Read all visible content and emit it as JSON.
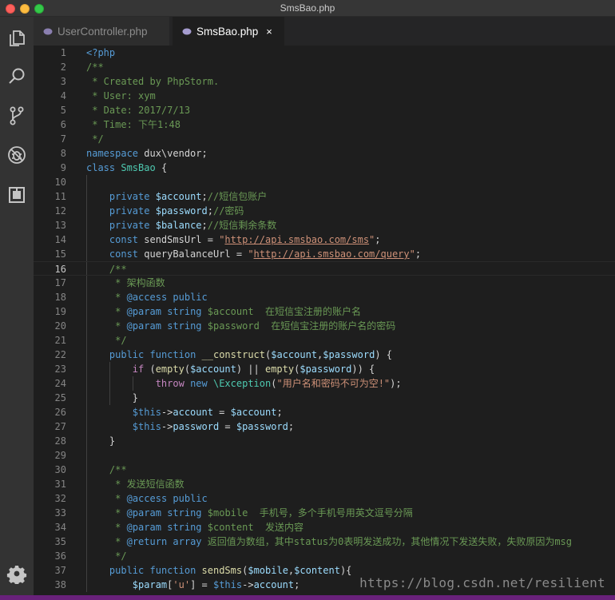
{
  "window": {
    "title": "SmsBao.php"
  },
  "activity_bar": {
    "items": [
      {
        "name": "explorer-icon"
      },
      {
        "name": "search-icon"
      },
      {
        "name": "source-control-icon"
      },
      {
        "name": "debug-icon"
      },
      {
        "name": "extensions-icon"
      }
    ],
    "settings": {
      "name": "gear-icon"
    }
  },
  "tabs": [
    {
      "label": "UserController.php",
      "active": false,
      "icon": "php-elephant-icon"
    },
    {
      "label": "SmsBao.php",
      "active": true,
      "icon": "php-elephant-icon",
      "close": "×"
    }
  ],
  "editor": {
    "current_line": 16,
    "lines": [
      {
        "n": "1",
        "t": [
          [
            "tag",
            "<?php"
          ]
        ]
      },
      {
        "n": "2",
        "t": [
          [
            "cm",
            "/**"
          ]
        ]
      },
      {
        "n": "3",
        "t": [
          [
            "cm",
            " * Created by PhpStorm."
          ]
        ]
      },
      {
        "n": "4",
        "t": [
          [
            "cm",
            " * User: xym"
          ]
        ]
      },
      {
        "n": "5",
        "t": [
          [
            "cm",
            " * Date: 2017/7/13"
          ]
        ]
      },
      {
        "n": "6",
        "t": [
          [
            "cm",
            " * Time: 下午1:48"
          ]
        ]
      },
      {
        "n": "7",
        "t": [
          [
            "cm",
            " */"
          ]
        ]
      },
      {
        "n": "8",
        "t": [
          [
            "kw",
            "namespace"
          ],
          [
            "plain",
            " dux\\vendor;"
          ]
        ]
      },
      {
        "n": "9",
        "t": [
          [
            "kw",
            "class"
          ],
          [
            "plain",
            " "
          ],
          [
            "cls",
            "SmsBao"
          ],
          [
            "plain",
            " {"
          ]
        ]
      },
      {
        "n": "10",
        "t": []
      },
      {
        "n": "11",
        "t": [
          [
            "plain",
            "    "
          ],
          [
            "kw",
            "private"
          ],
          [
            "plain",
            " "
          ],
          [
            "var",
            "$account"
          ],
          [
            "plain",
            ";"
          ],
          [
            "cm",
            "//短信包账户"
          ]
        ]
      },
      {
        "n": "12",
        "t": [
          [
            "plain",
            "    "
          ],
          [
            "kw",
            "private"
          ],
          [
            "plain",
            " "
          ],
          [
            "var",
            "$password"
          ],
          [
            "plain",
            ";"
          ],
          [
            "cm",
            "//密码"
          ]
        ]
      },
      {
        "n": "13",
        "t": [
          [
            "plain",
            "    "
          ],
          [
            "kw",
            "private"
          ],
          [
            "plain",
            " "
          ],
          [
            "var",
            "$balance"
          ],
          [
            "plain",
            ";"
          ],
          [
            "cm",
            "//短信剩余条数"
          ]
        ]
      },
      {
        "n": "14",
        "t": [
          [
            "plain",
            "    "
          ],
          [
            "kw",
            "const"
          ],
          [
            "plain",
            " sendSmsUrl = "
          ],
          [
            "str",
            "\""
          ],
          [
            "url",
            "http://api.smsbao.com/sms"
          ],
          [
            "str",
            "\""
          ],
          [
            "plain",
            ";"
          ]
        ]
      },
      {
        "n": "15",
        "t": [
          [
            "plain",
            "    "
          ],
          [
            "kw",
            "const"
          ],
          [
            "plain",
            " queryBalanceUrl = "
          ],
          [
            "str",
            "\""
          ],
          [
            "url",
            "http://api.smsbao.com/query"
          ],
          [
            "str",
            "\""
          ],
          [
            "plain",
            ";"
          ]
        ]
      },
      {
        "n": "16",
        "t": [
          [
            "plain",
            "    "
          ],
          [
            "cm",
            "/**"
          ]
        ]
      },
      {
        "n": "17",
        "t": [
          [
            "plain",
            "    "
          ],
          [
            "cm",
            " * 架构函数"
          ]
        ]
      },
      {
        "n": "18",
        "t": [
          [
            "plain",
            "    "
          ],
          [
            "cm",
            " * "
          ],
          [
            "kw",
            "@access"
          ],
          [
            "plain",
            " "
          ],
          [
            "kw",
            "public"
          ]
        ]
      },
      {
        "n": "19",
        "t": [
          [
            "plain",
            "    "
          ],
          [
            "cm",
            " * "
          ],
          [
            "kw",
            "@param"
          ],
          [
            "plain",
            " "
          ],
          [
            "kw",
            "string"
          ],
          [
            "cm",
            " $account  在短信宝注册的账户名"
          ]
        ]
      },
      {
        "n": "20",
        "t": [
          [
            "plain",
            "    "
          ],
          [
            "cm",
            " * "
          ],
          [
            "kw",
            "@param"
          ],
          [
            "plain",
            " "
          ],
          [
            "kw",
            "string"
          ],
          [
            "cm",
            " $password  在短信宝注册的账户名的密码"
          ]
        ]
      },
      {
        "n": "21",
        "t": [
          [
            "plain",
            "    "
          ],
          [
            "cm",
            " */"
          ]
        ]
      },
      {
        "n": "22",
        "t": [
          [
            "plain",
            "    "
          ],
          [
            "kw",
            "public"
          ],
          [
            "plain",
            " "
          ],
          [
            "kw",
            "function"
          ],
          [
            "plain",
            " "
          ],
          [
            "fn",
            "__construct"
          ],
          [
            "plain",
            "("
          ],
          [
            "var",
            "$account"
          ],
          [
            "plain",
            ","
          ],
          [
            "var",
            "$password"
          ],
          [
            "plain",
            ") {"
          ]
        ]
      },
      {
        "n": "23",
        "t": [
          [
            "plain",
            "        "
          ],
          [
            "ctl",
            "if"
          ],
          [
            "plain",
            " ("
          ],
          [
            "fn",
            "empty"
          ],
          [
            "plain",
            "("
          ],
          [
            "var",
            "$account"
          ],
          [
            "plain",
            ") || "
          ],
          [
            "fn",
            "empty"
          ],
          [
            "plain",
            "("
          ],
          [
            "var",
            "$password"
          ],
          [
            "plain",
            ")) {"
          ]
        ]
      },
      {
        "n": "24",
        "t": [
          [
            "plain",
            "            "
          ],
          [
            "ctl",
            "throw"
          ],
          [
            "plain",
            " "
          ],
          [
            "kw",
            "new"
          ],
          [
            "plain",
            " "
          ],
          [
            "cls",
            "\\Exception"
          ],
          [
            "plain",
            "("
          ],
          [
            "str",
            "\"用户名和密码不可为空!\""
          ],
          [
            "plain",
            ");"
          ]
        ]
      },
      {
        "n": "25",
        "t": [
          [
            "plain",
            "        }"
          ]
        ]
      },
      {
        "n": "26",
        "t": [
          [
            "plain",
            "        "
          ],
          [
            "kw",
            "$this"
          ],
          [
            "plain",
            "->"
          ],
          [
            "var",
            "account"
          ],
          [
            "plain",
            " = "
          ],
          [
            "var",
            "$account"
          ],
          [
            "plain",
            ";"
          ]
        ]
      },
      {
        "n": "27",
        "t": [
          [
            "plain",
            "        "
          ],
          [
            "kw",
            "$this"
          ],
          [
            "plain",
            "->"
          ],
          [
            "var",
            "password"
          ],
          [
            "plain",
            " = "
          ],
          [
            "var",
            "$password"
          ],
          [
            "plain",
            ";"
          ]
        ]
      },
      {
        "n": "28",
        "t": [
          [
            "plain",
            "    }"
          ]
        ]
      },
      {
        "n": "29",
        "t": []
      },
      {
        "n": "30",
        "t": [
          [
            "plain",
            "    "
          ],
          [
            "cm",
            "/**"
          ]
        ]
      },
      {
        "n": "31",
        "t": [
          [
            "plain",
            "    "
          ],
          [
            "cm",
            " * 发送短信函数"
          ]
        ]
      },
      {
        "n": "32",
        "t": [
          [
            "plain",
            "    "
          ],
          [
            "cm",
            " * "
          ],
          [
            "kw",
            "@access"
          ],
          [
            "plain",
            " "
          ],
          [
            "kw",
            "public"
          ]
        ]
      },
      {
        "n": "33",
        "t": [
          [
            "plain",
            "    "
          ],
          [
            "cm",
            " * "
          ],
          [
            "kw",
            "@param"
          ],
          [
            "plain",
            " "
          ],
          [
            "kw",
            "string"
          ],
          [
            "cm",
            " $mobile  手机号，多个手机号用英文逗号分隔"
          ]
        ]
      },
      {
        "n": "34",
        "t": [
          [
            "plain",
            "    "
          ],
          [
            "cm",
            " * "
          ],
          [
            "kw",
            "@param"
          ],
          [
            "plain",
            " "
          ],
          [
            "kw",
            "string"
          ],
          [
            "cm",
            " $content  发送内容"
          ]
        ]
      },
      {
        "n": "35",
        "t": [
          [
            "plain",
            "    "
          ],
          [
            "cm",
            " * "
          ],
          [
            "kw",
            "@return"
          ],
          [
            "plain",
            " "
          ],
          [
            "kw",
            "array"
          ],
          [
            "cm",
            " 返回值为数组，其中status为0表明发送成功，其他情况下发送失败，失败原因为msg"
          ]
        ]
      },
      {
        "n": "36",
        "t": [
          [
            "plain",
            "    "
          ],
          [
            "cm",
            " */"
          ]
        ]
      },
      {
        "n": "37",
        "t": [
          [
            "plain",
            "    "
          ],
          [
            "kw",
            "public"
          ],
          [
            "plain",
            " "
          ],
          [
            "kw",
            "function"
          ],
          [
            "plain",
            " "
          ],
          [
            "fn",
            "sendSms"
          ],
          [
            "plain",
            "("
          ],
          [
            "var",
            "$mobile"
          ],
          [
            "plain",
            ","
          ],
          [
            "var",
            "$content"
          ],
          [
            "plain",
            "){"
          ]
        ]
      },
      {
        "n": "38",
        "t": [
          [
            "plain",
            "        "
          ],
          [
            "var",
            "$param"
          ],
          [
            "plain",
            "["
          ],
          [
            "str",
            "'u'"
          ],
          [
            "plain",
            "] = "
          ],
          [
            "kw",
            "$this"
          ],
          [
            "plain",
            "->"
          ],
          [
            "var",
            "account"
          ],
          [
            "plain",
            ";"
          ]
        ]
      }
    ]
  },
  "watermark": "https://blog.csdn.net/resilient",
  "colors": {
    "accent_statusbar": "#68217a",
    "editor_bg": "#1e1e1e",
    "keyword": "#569cd6",
    "comment": "#6a9955",
    "string": "#ce9178",
    "variable": "#9cdcfe",
    "function": "#dcdcaa"
  }
}
